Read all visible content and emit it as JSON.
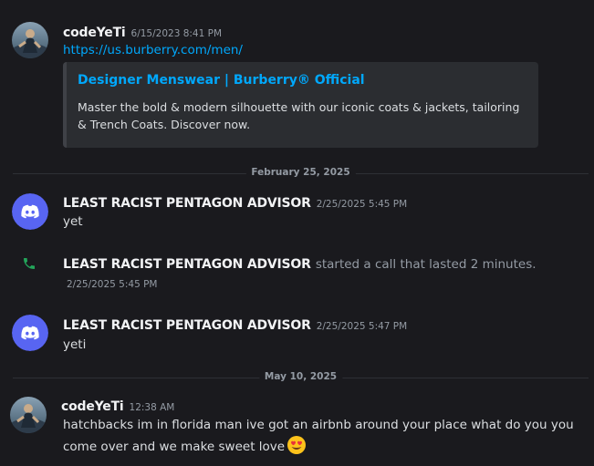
{
  "messages": [
    {
      "author": "codeYeTi",
      "timestamp": "6/15/2023 8:41 PM",
      "link": "https://us.burberry.com/men/",
      "embed": {
        "title": "Designer Menswear | Burberry® Official",
        "description": "Master the bold & modern silhouette with our iconic coats & jackets, tailoring & Trench Coats. Discover now."
      }
    },
    {
      "author": "LEAST RACIST PENTAGON ADVISOR",
      "timestamp": "2/25/2025 5:45 PM",
      "text": "yet"
    },
    {
      "author": "LEAST RACIST PENTAGON ADVISOR",
      "text": "started a call that lasted 2 minutes.",
      "timestamp": "2/25/2025 5:45 PM"
    },
    {
      "author": "LEAST RACIST PENTAGON ADVISOR",
      "timestamp": "2/25/2025 5:47 PM",
      "text": "yeti"
    },
    {
      "author": "codeYeTi",
      "timestamp": "12:38 AM",
      "text_line1": "hatchbacks im in florida man ive got an airbnb around your place what do you you",
      "text_line2": "come over and we make sweet love"
    }
  ],
  "dividers": [
    "February 25, 2025",
    "May 10, 2025"
  ],
  "icons": {
    "avatar_user": "yeti-avatar",
    "avatar_bot": "discord-logo-icon",
    "call": "phone-icon",
    "emoji": "heart-eyes-emoji"
  },
  "colors": {
    "background": "#1a1a1e",
    "link": "#00a8fc",
    "discord_blurple": "#5865f2",
    "call_green": "#23a55a"
  }
}
